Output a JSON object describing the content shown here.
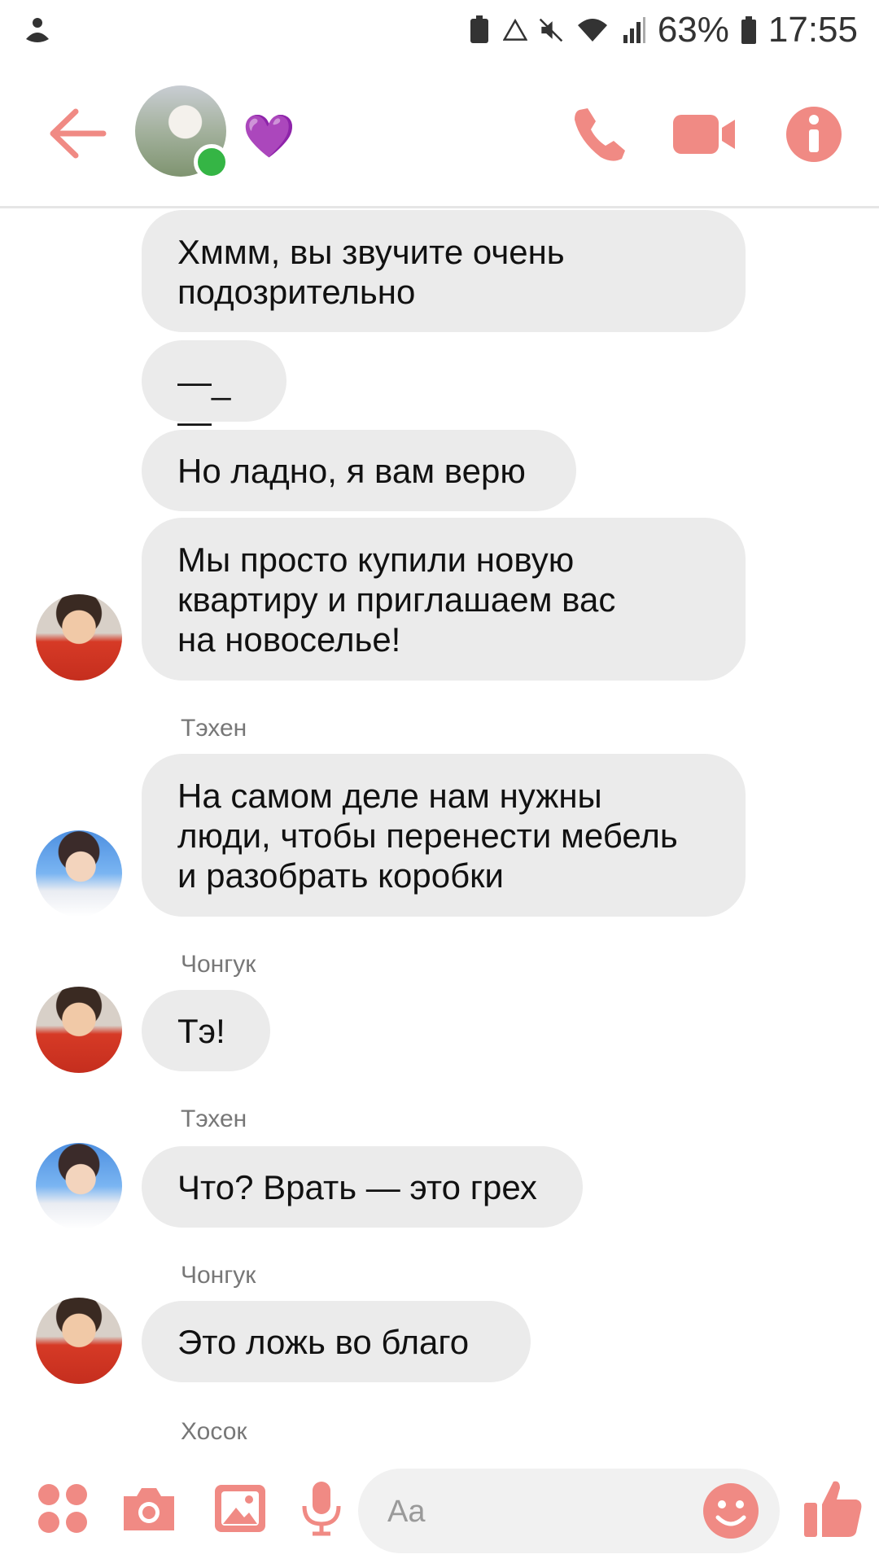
{
  "status_bar": {
    "battery": "63%",
    "time": "17:55"
  },
  "header": {
    "contact_emoji": "💜"
  },
  "messages": [
    {
      "lines": [
        "Хммм, вы звучите очень",
        "подозрительно"
      ]
    },
    {
      "lines": [
        "—_—"
      ]
    },
    {
      "lines": [
        "Но ладно, я вам верю"
      ]
    },
    {
      "lines": [
        "Мы просто купили новую",
        "квартиру и приглашаем вас",
        "на новоселье!"
      ]
    },
    {
      "sender": "Тэхен",
      "lines": [
        "На самом деле нам нужны",
        "люди, чтобы перенести мебель",
        "и разобрать коробки"
      ]
    },
    {
      "sender": "Чонгук",
      "lines": [
        "Тэ!"
      ]
    },
    {
      "sender": "Тэхен",
      "lines": [
        "Что? Врать — это грех"
      ]
    },
    {
      "sender": "Чонгук",
      "lines": [
        "Это ложь во благо"
      ]
    },
    {
      "sender": "Хосок"
    }
  ],
  "composer": {
    "placeholder": "Aa"
  },
  "colors": {
    "accent": "#f08a84",
    "bubble": "#ebebeb",
    "online": "#35b545"
  }
}
